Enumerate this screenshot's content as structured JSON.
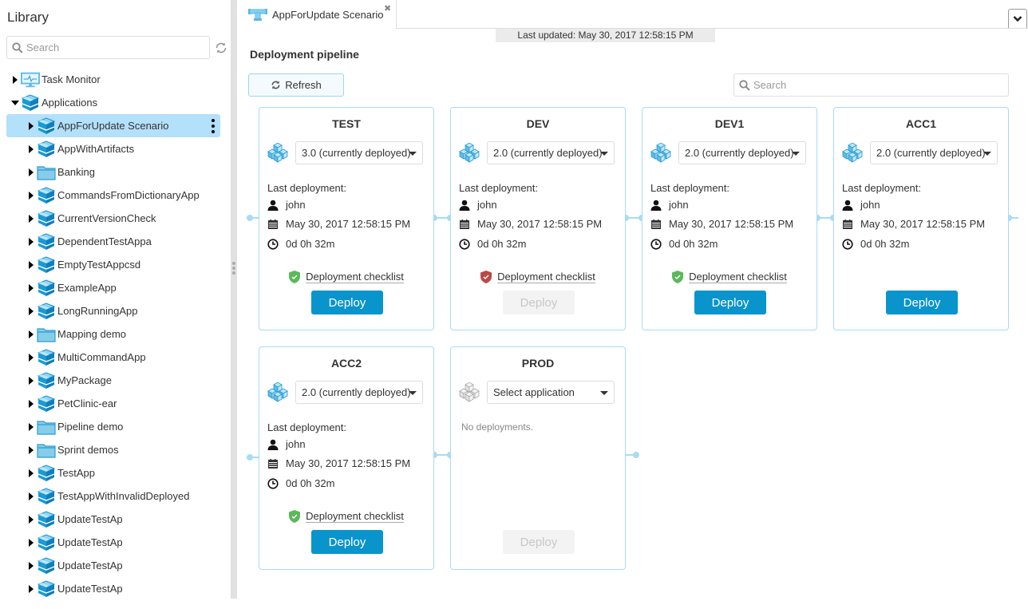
{
  "sidebar": {
    "title": "Library",
    "search_placeholder": "Search",
    "tree": [
      {
        "label": "Task Monitor",
        "icon": "monitor-icon",
        "level": 0,
        "expanded": false
      },
      {
        "label": "Applications",
        "icon": "package-icon",
        "level": 0,
        "expanded": true
      },
      {
        "label": "AppForUpdate Scenario",
        "icon": "package-icon",
        "level": 1,
        "selected": true
      },
      {
        "label": "AppWithArtifacts",
        "icon": "package-icon",
        "level": 1
      },
      {
        "label": "Banking",
        "icon": "folder-icon",
        "level": 1
      },
      {
        "label": "CommandsFromDictionaryApp",
        "icon": "package-icon",
        "level": 1
      },
      {
        "label": "CurrentVersionCheck",
        "icon": "package-icon",
        "level": 1
      },
      {
        "label": "DependentTestAppa",
        "icon": "package-icon",
        "level": 1
      },
      {
        "label": "EmptyTestAppcsd",
        "icon": "package-icon",
        "level": 1
      },
      {
        "label": "ExampleApp",
        "icon": "package-icon",
        "level": 1
      },
      {
        "label": "LongRunningApp",
        "icon": "package-icon",
        "level": 1
      },
      {
        "label": "Mapping demo",
        "icon": "folder-icon",
        "level": 1
      },
      {
        "label": "MultiCommandApp",
        "icon": "package-icon",
        "level": 1
      },
      {
        "label": "MyPackage",
        "icon": "package-icon",
        "level": 1
      },
      {
        "label": "PetClinic-ear",
        "icon": "package-icon",
        "level": 1
      },
      {
        "label": "Pipeline demo",
        "icon": "folder-icon",
        "level": 1
      },
      {
        "label": "Sprint demos",
        "icon": "folder-icon",
        "level": 1
      },
      {
        "label": "TestApp",
        "icon": "package-icon",
        "level": 1
      },
      {
        "label": "TestAppWithInvalidDeployed",
        "icon": "package-icon",
        "level": 1
      },
      {
        "label": "UpdateTestAp",
        "icon": "package-icon",
        "level": 1
      },
      {
        "label": "UpdateTestAp",
        "icon": "package-icon",
        "level": 1
      },
      {
        "label": "UpdateTestAp",
        "icon": "package-icon",
        "level": 1
      },
      {
        "label": "UpdateTestAp",
        "icon": "package-icon",
        "level": 1
      }
    ]
  },
  "tab": {
    "label": "AppForUpdate Scenario",
    "icon": "pipeline-icon",
    "close_glyph": "✖"
  },
  "main": {
    "last_updated": "Last updated: May 30, 2017 12:58:15 PM",
    "title": "Deployment pipeline",
    "refresh_label": "Refresh",
    "search_placeholder": "Search"
  },
  "colors": {
    "accent": "#0a94cc",
    "selected_row": "#b3e0fb",
    "connector": "#a8dcf3",
    "check_ok": "#5cb85c",
    "check_fail": "#b94a48"
  },
  "stages": [
    {
      "name": "TEST",
      "version": "3.0 (currently deployed)",
      "has_deployment": true,
      "last_deployment_label": "Last deployment:",
      "user": "john",
      "date": "May 30, 2017 12:58:15 PM",
      "duration": "0d 0h 32m",
      "checklist": "Deployment checklist",
      "checklist_status": "ok",
      "deploy_label": "Deploy",
      "deploy_enabled": true
    },
    {
      "name": "DEV",
      "version": "2.0 (currently deployed)",
      "has_deployment": true,
      "last_deployment_label": "Last deployment:",
      "user": "john",
      "date": "May 30, 2017 12:58:15 PM",
      "duration": "0d 0h 32m",
      "checklist": "Deployment checklist",
      "checklist_status": "fail",
      "deploy_label": "Deploy",
      "deploy_enabled": false
    },
    {
      "name": "DEV1",
      "version": "2.0 (currently deployed)",
      "has_deployment": true,
      "last_deployment_label": "Last deployment:",
      "user": "john",
      "date": "May 30, 2017 12:58:15 PM",
      "duration": "0d 0h 32m",
      "checklist": "Deployment checklist",
      "checklist_status": "ok",
      "deploy_label": "Deploy",
      "deploy_enabled": true
    },
    {
      "name": "ACC1",
      "version": "2.0 (currently deployed)",
      "has_deployment": true,
      "last_deployment_label": "Last  deployment:",
      "user": "john",
      "date": "May 30, 2017 12:58:15 PM",
      "duration": "0d 0h 32m",
      "checklist": null,
      "checklist_status": null,
      "deploy_label": "Deploy",
      "deploy_enabled": true
    },
    {
      "name": "ACC2",
      "version": "2.0 (currently deployed)",
      "has_deployment": true,
      "last_deployment_label": "Last deployment:",
      "user": "john",
      "date": "May 30, 2017 12:58:15 PM",
      "duration": "0d 0h 32m",
      "checklist": "Deployment checklist",
      "checklist_status": "ok",
      "deploy_label": "Deploy",
      "deploy_enabled": true
    },
    {
      "name": "PROD",
      "version": "Select application",
      "has_deployment": false,
      "no_deployments_text": "No deployments.",
      "checklist": null,
      "checklist_status": null,
      "deploy_label": "Deploy",
      "deploy_enabled": false
    }
  ]
}
